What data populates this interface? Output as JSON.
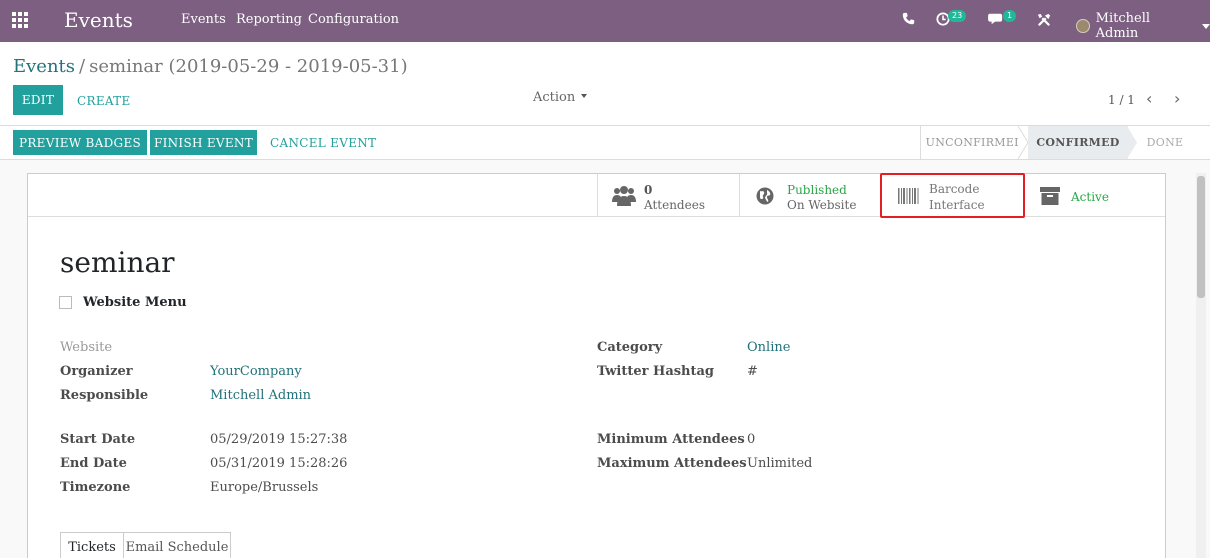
{
  "navbar": {
    "brand": "Events",
    "menu": [
      "Events",
      "Reporting",
      "Configuration"
    ],
    "activity_badge": "23",
    "message_badge": "1",
    "user": "Mitchell Admin"
  },
  "control": {
    "breadcrumb_root": "Events",
    "breadcrumb_current": "seminar (2019-05-29 - 2019-05-31)",
    "edit_label": "EDIT",
    "create_label": "CREATE",
    "action_label": "Action",
    "pager": "1 / 1"
  },
  "status": {
    "buttons": {
      "preview_badges": "PREVIEW BADGES",
      "finish_event": "FINISH EVENT",
      "cancel_event": "CANCEL EVENT"
    },
    "stages": [
      "UNCONFIRMED",
      "CONFIRMED",
      "DONE"
    ],
    "active_stage": "CONFIRMED"
  },
  "smart_buttons": {
    "attendees_count": "0",
    "attendees_label": "Attendees",
    "published_line1": "Published",
    "published_line2": "On Website",
    "barcode_line1": "Barcode",
    "barcode_line2": "Interface",
    "active_label": "Active"
  },
  "record": {
    "name": "seminar",
    "website_menu_label": "Website Menu",
    "left_fields": [
      {
        "label": "Website",
        "value": ""
      },
      {
        "label": "Organizer",
        "value": "YourCompany"
      },
      {
        "label": "Responsible",
        "value": "Mitchell Admin"
      },
      {
        "label": "Start Date",
        "value": "05/29/2019 15:27:38"
      },
      {
        "label": "End Date",
        "value": "05/31/2019 15:28:26"
      },
      {
        "label": "Timezone",
        "value": "Europe/Brussels"
      }
    ],
    "right_fields": [
      {
        "label": "Category",
        "value": "Online"
      },
      {
        "label": "Twitter Hashtag",
        "value": "#"
      },
      {
        "label": "Minimum Attendees",
        "value": "0"
      },
      {
        "label": "Maximum Attendees",
        "value": "Unlimited"
      }
    ],
    "tabs": [
      "Tickets",
      "Email Schedule"
    ]
  },
  "colors": {
    "navbar": "#7c5f81",
    "primary": "#21a09d",
    "link": "#21727a",
    "highlight": "#e31e24",
    "badge": "#21b799"
  }
}
